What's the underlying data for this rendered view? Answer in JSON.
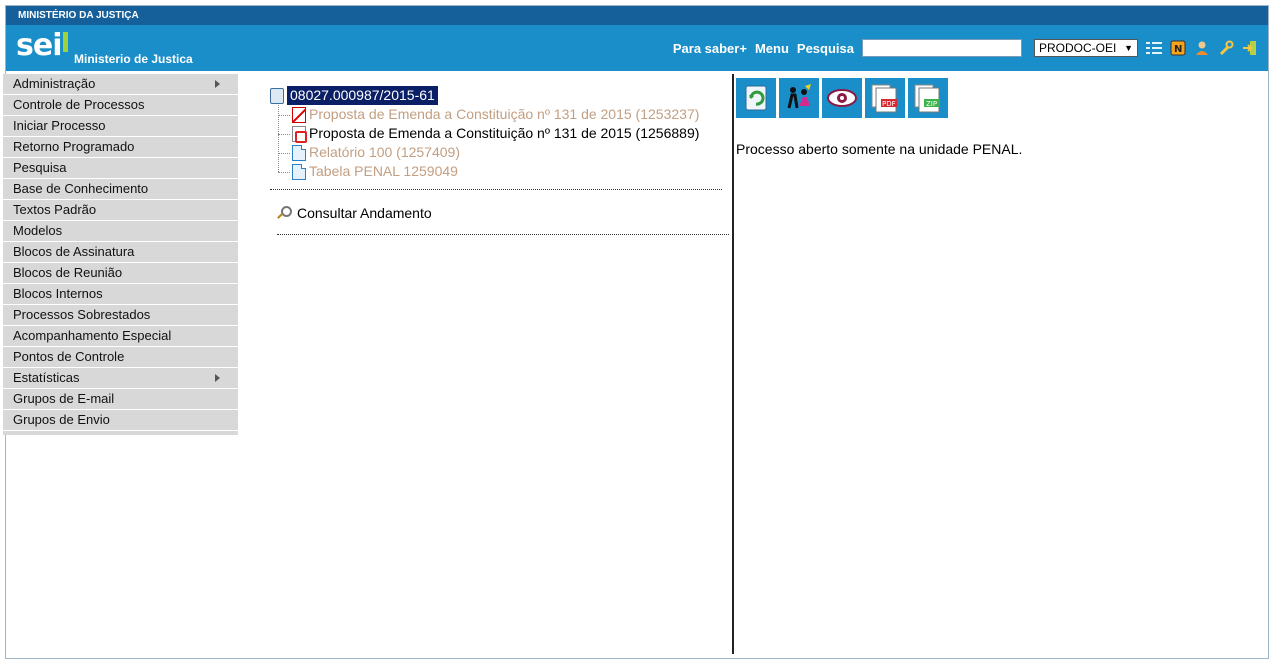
{
  "topbar": {
    "ministry": "MINISTÉRIO DA JUSTIÇA"
  },
  "header": {
    "logo_text": "sei",
    "org_name": "Ministerio de Justica",
    "links": {
      "para_saber": "Para saber+",
      "menu": "Menu",
      "pesquisa": "Pesquisa"
    },
    "search_value": "",
    "unit": "PRODOC-OEI",
    "icons": [
      "list-icon",
      "notes-icon",
      "user-icon",
      "wrench-icon",
      "exit-icon"
    ]
  },
  "sidebar": {
    "items": [
      {
        "label": "Administração",
        "has_submenu": true
      },
      {
        "label": "Controle de Processos",
        "has_submenu": false
      },
      {
        "label": "Iniciar Processo",
        "has_submenu": false
      },
      {
        "label": "Retorno Programado",
        "has_submenu": false
      },
      {
        "label": "Pesquisa",
        "has_submenu": false
      },
      {
        "label": "Base de Conhecimento",
        "has_submenu": false
      },
      {
        "label": "Textos Padrão",
        "has_submenu": false
      },
      {
        "label": "Modelos",
        "has_submenu": false
      },
      {
        "label": "Blocos de Assinatura",
        "has_submenu": false
      },
      {
        "label": "Blocos de Reunião",
        "has_submenu": false
      },
      {
        "label": "Blocos Internos",
        "has_submenu": false
      },
      {
        "label": "Processos Sobrestados",
        "has_submenu": false
      },
      {
        "label": "Acompanhamento Especial",
        "has_submenu": false
      },
      {
        "label": "Pontos de Controle",
        "has_submenu": false
      },
      {
        "label": "Estatísticas",
        "has_submenu": true
      },
      {
        "label": "Grupos de E-mail",
        "has_submenu": false
      },
      {
        "label": "Grupos de Envio",
        "has_submenu": false
      }
    ]
  },
  "tree": {
    "process_number": "08027.000987/2015-61",
    "documents": [
      {
        "label": "Proposta de Emenda a Constituição nº 131 de 2015 (1253237)",
        "icon": "cancelled-document-icon"
      },
      {
        "label": "Proposta de Emenda a Constituição nº 131 de 2015 (1256889)",
        "icon": "pdf-document-icon"
      },
      {
        "label": "Relatório 100 (1257409)",
        "icon": "document-icon"
      },
      {
        "label": "Tabela PENAL 1259049",
        "icon": "document-icon"
      }
    ],
    "consult_label": "Consultar Andamento"
  },
  "right": {
    "actions": [
      {
        "name": "send-process-button",
        "icon": "send-icon"
      },
      {
        "name": "assign-process-button",
        "icon": "people-icon"
      },
      {
        "name": "view-process-button",
        "icon": "eye-icon"
      },
      {
        "name": "generate-pdf-button",
        "icon": "pdf-icon",
        "tag": "PDF"
      },
      {
        "name": "generate-zip-button",
        "icon": "zip-icon",
        "tag": "ZIP"
      }
    ],
    "message": "Processo aberto somente na unidade PENAL."
  }
}
